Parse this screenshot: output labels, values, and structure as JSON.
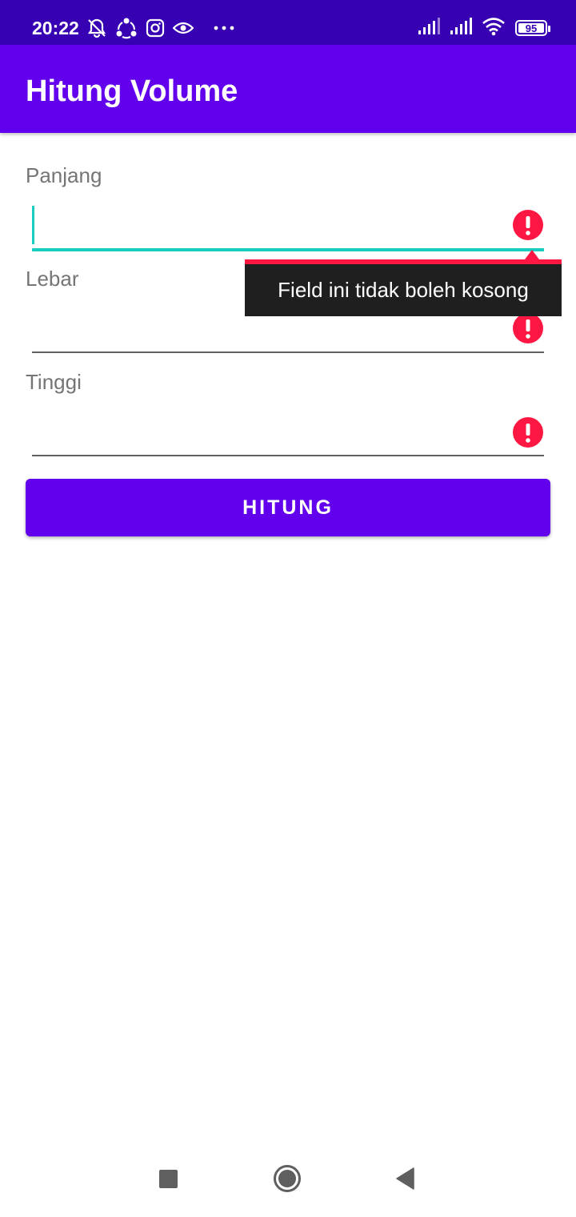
{
  "status_bar": {
    "time": "20:22",
    "left_icons": [
      "alarm-off-icon",
      "share-icon",
      "instagram-icon",
      "eye-icon",
      "more-icon"
    ],
    "right_icons": [
      "signal-icon",
      "signal-icon",
      "wifi-icon",
      "battery-icon"
    ],
    "battery_level": "95"
  },
  "app_bar": {
    "title": "Hitung Volume"
  },
  "fields": [
    {
      "label": "Panjang",
      "value": "",
      "error": true,
      "focused": true
    },
    {
      "label": "Lebar",
      "value": "",
      "error": true,
      "focused": false
    },
    {
      "label": "Tinggi",
      "value": "",
      "error": true,
      "focused": false
    }
  ],
  "error_tooltip": {
    "text": "Field ini tidak boleh kosong"
  },
  "calculate_button": {
    "label": "HITUNG"
  },
  "colors": {
    "status_bar": "#3700b3",
    "app_bar": "#6200ee",
    "button": "#6200ee",
    "focus_accent": "#18cec0",
    "error": "#ff1744",
    "tooltip_bg": "#1f1f1f"
  },
  "nav_bar": {
    "buttons": [
      "recent-apps-icon",
      "home-icon",
      "back-icon"
    ]
  }
}
